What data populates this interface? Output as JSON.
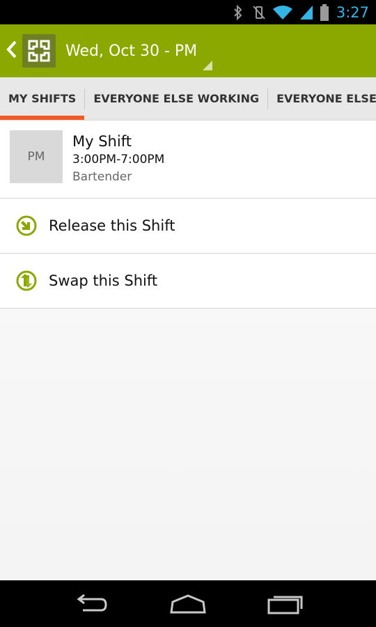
{
  "status_bar": {
    "time": "3:27",
    "icons": [
      "bluetooth-icon",
      "vibrate-off-icon",
      "wifi-icon",
      "signal-icon",
      "battery-icon"
    ],
    "accent_color": "#33b5e5"
  },
  "action_bar": {
    "title": "Wed, Oct 30 - PM",
    "background_color": "#8aa800"
  },
  "tabs": [
    {
      "label": "MY SHIFTS",
      "active": true
    },
    {
      "label": "EVERYONE ELSE WORKING",
      "active": false
    },
    {
      "label": "EVERYONE ELSE NOT WORKING",
      "active": false
    }
  ],
  "tab_indicator_color": "#f15a24",
  "shift": {
    "period": "PM",
    "title": "My Shift",
    "time": "3:00PM-7:00PM",
    "role": "Bartender"
  },
  "actions": [
    {
      "label": "Release this Shift",
      "icon": "release-icon"
    },
    {
      "label": "Swap this Shift",
      "icon": "swap-icon"
    }
  ],
  "icon_color": "#8aa800",
  "nav": {
    "icons": [
      "back-icon",
      "home-icon",
      "recent-apps-icon"
    ]
  }
}
